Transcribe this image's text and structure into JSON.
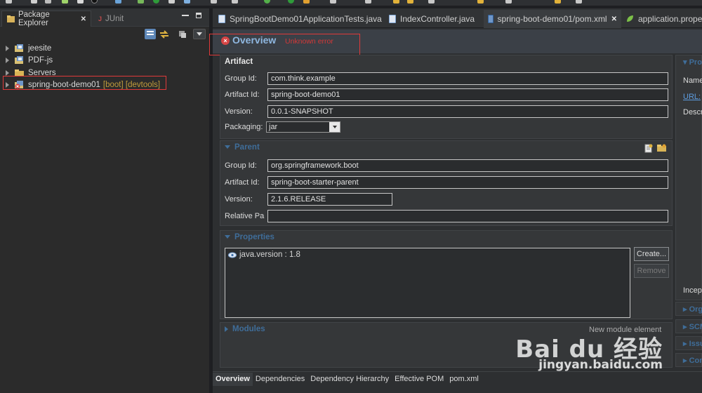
{
  "left_panel": {
    "tabs": [
      {
        "label": "Package Explorer",
        "close": "✕"
      },
      {
        "label": "JUnit"
      }
    ],
    "tree": [
      {
        "name": "jeesite"
      },
      {
        "name": "PDF-js"
      },
      {
        "name": "Servers"
      },
      {
        "name": "spring-boot-demo01",
        "decorations": "[boot] [devtools]"
      }
    ]
  },
  "editor": {
    "tabs": [
      {
        "label": "SpringBootDemo01ApplicationTests.java"
      },
      {
        "label": "IndexController.java"
      },
      {
        "label": "spring-boot-demo01/pom.xml",
        "close": "✕"
      },
      {
        "label": "application.propert"
      }
    ],
    "header": {
      "title": "Overview",
      "error": "Unknown error"
    },
    "artifact": {
      "title": "Artifact",
      "group_id": {
        "label": "Group Id:",
        "value": "com.think.example"
      },
      "artifact_id": {
        "label": "Artifact Id:",
        "value": "spring-boot-demo01"
      },
      "version": {
        "label": "Version:",
        "value": "0.0.1-SNAPSHOT"
      },
      "packaging": {
        "label": "Packaging:",
        "value": "jar"
      }
    },
    "parent": {
      "title": "Parent",
      "group_id": {
        "label": "Group Id:",
        "value": "org.springframework.boot"
      },
      "artifact_id": {
        "label": "Artifact Id:",
        "value": "spring-boot-starter-parent"
      },
      "version": {
        "label": "Version:",
        "value": "2.1.6.RELEASE"
      },
      "relative_path": {
        "label": "Relative Pa",
        "value": ""
      }
    },
    "properties": {
      "title": "Properties",
      "items": [
        {
          "text": "java.version : 1.8"
        }
      ],
      "create_label": "Create...",
      "remove_label": "Remove"
    },
    "modules": {
      "title": "Modules",
      "hint": "New module element"
    },
    "bottom_tabs": [
      {
        "label": "Overview"
      },
      {
        "label": "Dependencies"
      },
      {
        "label": "Dependency Hierarchy"
      },
      {
        "label": "Effective POM"
      },
      {
        "label": "pom.xml"
      }
    ]
  },
  "right": {
    "project_title": "Pro",
    "name_label": "Name",
    "url_label": "URL:",
    "desc_label": "Descr",
    "incep_label": "Incep",
    "sections": [
      "Org",
      "SCM",
      "Issu",
      "Con"
    ]
  },
  "watermark": {
    "main": "Bai du 经验",
    "sub": "jingyan.baidu.com"
  },
  "colors": {
    "background": "#2b2b2b",
    "accent_blue": "#3f6d99",
    "title_blue": "#8fb7e0",
    "error_red": "#d23838",
    "highlight_box": "#e03a3a",
    "decoration": "#c09b3a"
  }
}
